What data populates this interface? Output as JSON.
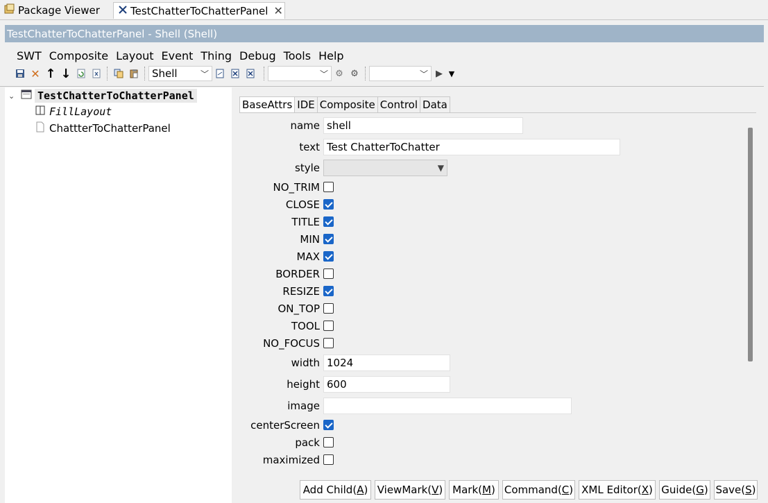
{
  "editor_tabs": [
    {
      "label": "Package Viewer",
      "active": false
    },
    {
      "label": "TestChatterToChatterPanel",
      "active": true
    }
  ],
  "title_bar": "TestChatterToChatterPanel - Shell  (Shell)",
  "menu": [
    "SWT",
    "Composite",
    "Layout",
    "Event",
    "Thing",
    "Debug",
    "Tools",
    "Help"
  ],
  "toolbar": {
    "type_combo_value": "Shell",
    "combo2_value": "",
    "combo3_value": ""
  },
  "tree": {
    "root": "TestChatterToChatterPanel",
    "children": [
      "FillLayout",
      "ChattterToChatterPanel"
    ]
  },
  "attr_tabs": [
    "BaseAttrs",
    "IDE",
    "Composite",
    "Control",
    "Data"
  ],
  "fields": {
    "name": {
      "label": "name",
      "value": "shell"
    },
    "text": {
      "label": "text",
      "value": "Test ChatterToChatter"
    },
    "style": {
      "label": "style",
      "value": ""
    },
    "width": {
      "label": "width",
      "value": "1024"
    },
    "height": {
      "label": "height",
      "value": "600"
    },
    "image": {
      "label": "image",
      "value": ""
    }
  },
  "checkboxes": [
    {
      "label": "NO_TRIM",
      "checked": false
    },
    {
      "label": "CLOSE",
      "checked": true
    },
    {
      "label": "TITLE",
      "checked": true
    },
    {
      "label": "MIN",
      "checked": true
    },
    {
      "label": "MAX",
      "checked": true
    },
    {
      "label": "BORDER",
      "checked": false
    },
    {
      "label": "RESIZE",
      "checked": true
    },
    {
      "label": "ON_TOP",
      "checked": false
    },
    {
      "label": "TOOL",
      "checked": false
    },
    {
      "label": "NO_FOCUS",
      "checked": false
    }
  ],
  "checkboxes2": [
    {
      "label": "centerScreen",
      "checked": true
    },
    {
      "label": "pack",
      "checked": false
    },
    {
      "label": "maximized",
      "checked": false
    }
  ],
  "buttons": [
    {
      "label": "Add Child(",
      "key": "A"
    },
    {
      "label": "ViewMark(",
      "key": "V"
    },
    {
      "label": "Mark(",
      "key": "M"
    },
    {
      "label": "Command(",
      "key": "C"
    },
    {
      "label": "XML Editor(",
      "key": "X"
    },
    {
      "label": "Guide(",
      "key": "G"
    },
    {
      "label": "Save(",
      "key": "S"
    }
  ],
  "colors": {
    "title_bar_bg": "#9fb4c8",
    "checkbox_on": "#1a66c8"
  }
}
